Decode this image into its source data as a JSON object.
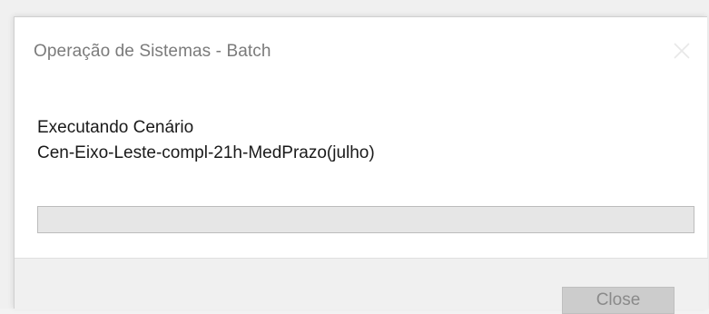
{
  "dialog": {
    "title": "Operação de Sistemas - Batch",
    "close_icon": "close-x-icon",
    "message_line1": "Executando Cenário",
    "message_line2": "Cen-Eixo-Leste-compl-21h-MedPrazo(julho)",
    "progress": {
      "percent": 0
    },
    "close_button_label": "Close",
    "close_button_enabled": false
  },
  "colors": {
    "title_text": "#7b7b7b",
    "footer_bg": "#f0f0f0",
    "progress_track": "#e6e6e6",
    "progress_fill": "#06b025",
    "disabled_button_bg": "#cccccc",
    "disabled_button_text": "#8a8a8a"
  }
}
